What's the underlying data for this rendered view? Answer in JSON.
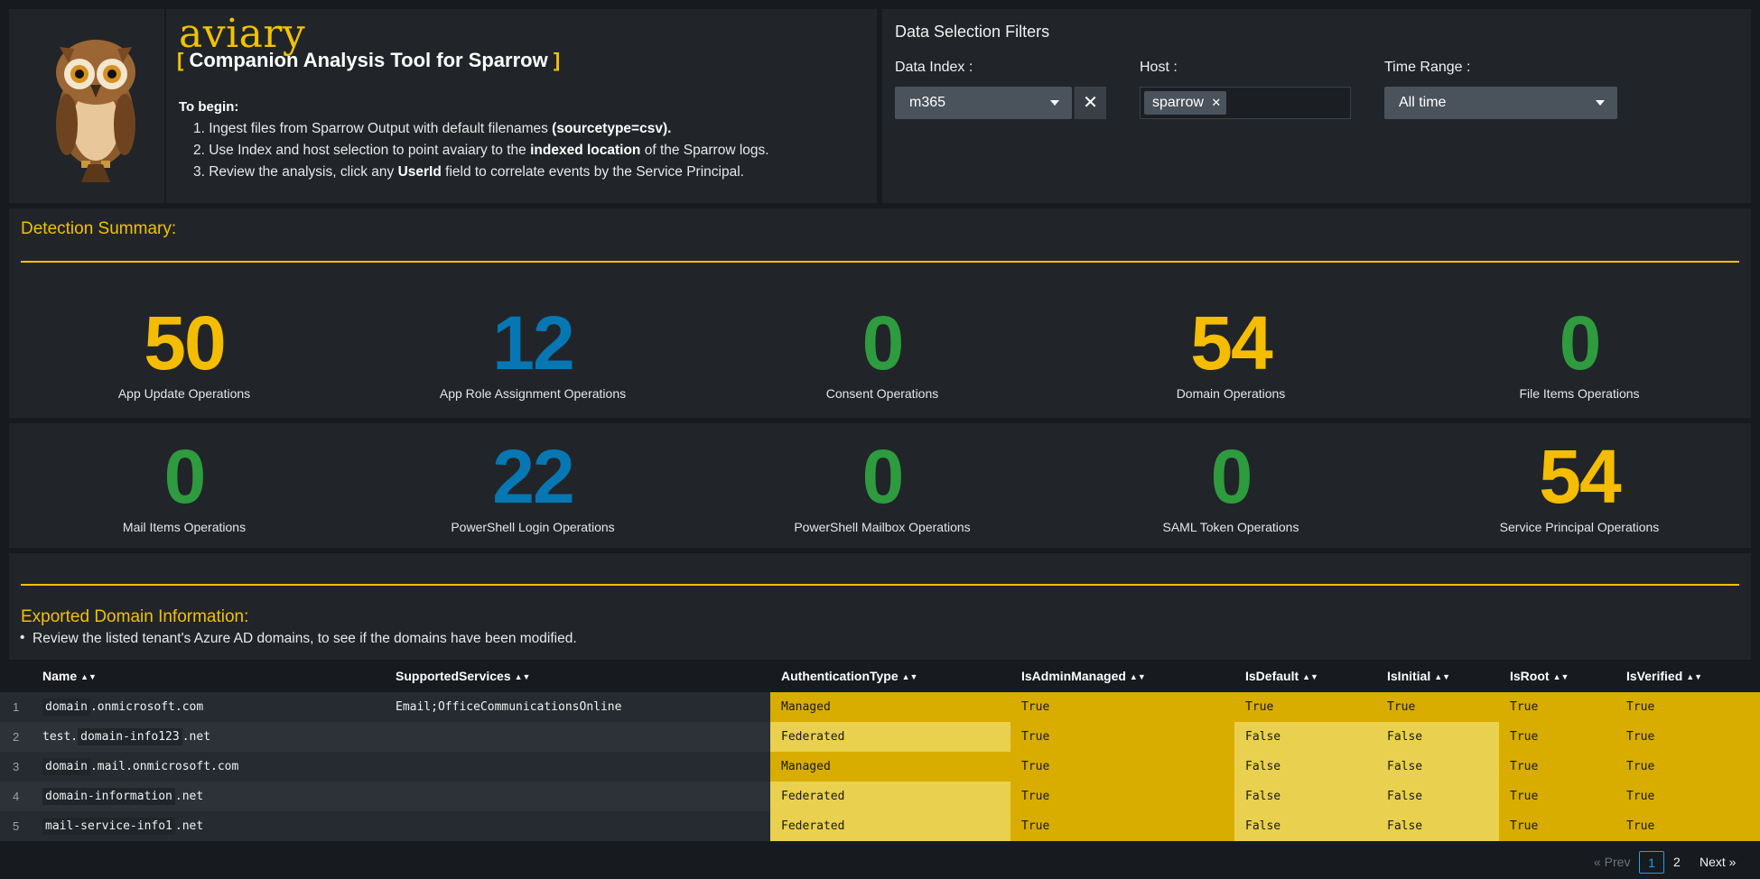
{
  "header": {
    "brand": "aviary",
    "subtitle_open": "[",
    "subtitle": " Companion Analysis Tool for Sparrow ",
    "subtitle_close": "]",
    "begin_label": "To begin:",
    "steps": [
      {
        "pre": "1. Ingest files from Sparrow Output with default filenames ",
        "bold": "(sourcetype=csv).",
        "post": ""
      },
      {
        "pre": "2. Use Index and host selection to point avaiary to the ",
        "bold": "indexed location",
        "post": " of the Sparrow logs."
      },
      {
        "pre": "3. Review the analysis, click any ",
        "bold": "UserId",
        "post": " field to correlate events by the Service Principal."
      }
    ]
  },
  "filters": {
    "title": "Data Selection Filters",
    "index_label": "Data Index :",
    "index_value": "m365",
    "host_label": "Host :",
    "host_chip": "sparrow",
    "time_label": "Time Range :",
    "time_value": "All time",
    "clear_glyph": "✕",
    "chip_remove_glyph": "✕"
  },
  "detection": {
    "title": "Detection Summary:",
    "metrics": [
      {
        "value": "50",
        "label": "App Update Operations",
        "color": "#f5bd00"
      },
      {
        "value": "12",
        "label": "App Role Assignment Operations",
        "color": "#0677b3"
      },
      {
        "value": "0",
        "label": "Consent Operations",
        "color": "#2e9b3e"
      },
      {
        "value": "54",
        "label": "Domain Operations",
        "color": "#f5bd00"
      },
      {
        "value": "0",
        "label": "File Items Operations",
        "color": "#2e9b3e"
      },
      {
        "value": "0",
        "label": "Mail Items Operations",
        "color": "#2e9b3e"
      },
      {
        "value": "22",
        "label": "PowerShell Login Operations",
        "color": "#0677b3"
      },
      {
        "value": "0",
        "label": "PowerShell Mailbox Operations",
        "color": "#2e9b3e"
      },
      {
        "value": "0",
        "label": "SAML Token Operations",
        "color": "#2e9b3e"
      },
      {
        "value": "54",
        "label": "Service Principal Operations",
        "color": "#f5bd00"
      }
    ]
  },
  "domain": {
    "title": "Exported Domain Information:",
    "bullet": "Review the listed tenant's Azure AD domains, to see if the domains have been modified."
  },
  "table": {
    "sort_glyph": "▲▼",
    "columns": [
      "Name",
      "SupportedServices",
      "AuthenticationType",
      "IsAdminManaged",
      "IsDefault",
      "IsInitial",
      "IsRoot",
      "IsVerified"
    ],
    "rows": [
      {
        "num": "1",
        "name_a": "domain",
        "name_b": ".onmicrosoft.com",
        "services": "Email;OfficeCommunicationsOnline",
        "auth": "Managed",
        "admin": "True",
        "def": "True",
        "init": "True",
        "root": "True",
        "verified": "True"
      },
      {
        "num": "2",
        "name_a": "test.",
        "name_b": "domain-info123",
        "name_c": ".net",
        "services": "",
        "auth": "Federated",
        "admin": "True",
        "def": "False",
        "init": "False",
        "root": "True",
        "verified": "True"
      },
      {
        "num": "3",
        "name_a": "domain",
        "name_b": ".mail.onmicrosoft.com",
        "services": "",
        "auth": "Managed",
        "admin": "True",
        "def": "False",
        "init": "False",
        "root": "True",
        "verified": "True"
      },
      {
        "num": "4",
        "name_a": "domain-information",
        "name_b": ".net",
        "services": "",
        "auth": "Federated",
        "admin": "True",
        "def": "False",
        "init": "False",
        "root": "True",
        "verified": "True"
      },
      {
        "num": "5",
        "name_a": "mail-service-info1",
        "name_b": ".net",
        "services": "",
        "auth": "Federated",
        "admin": "True",
        "def": "False",
        "init": "False",
        "root": "True",
        "verified": "True"
      }
    ]
  },
  "pagination": {
    "prev": "« Prev",
    "page1": "1",
    "page2": "2",
    "next": "Next »"
  }
}
